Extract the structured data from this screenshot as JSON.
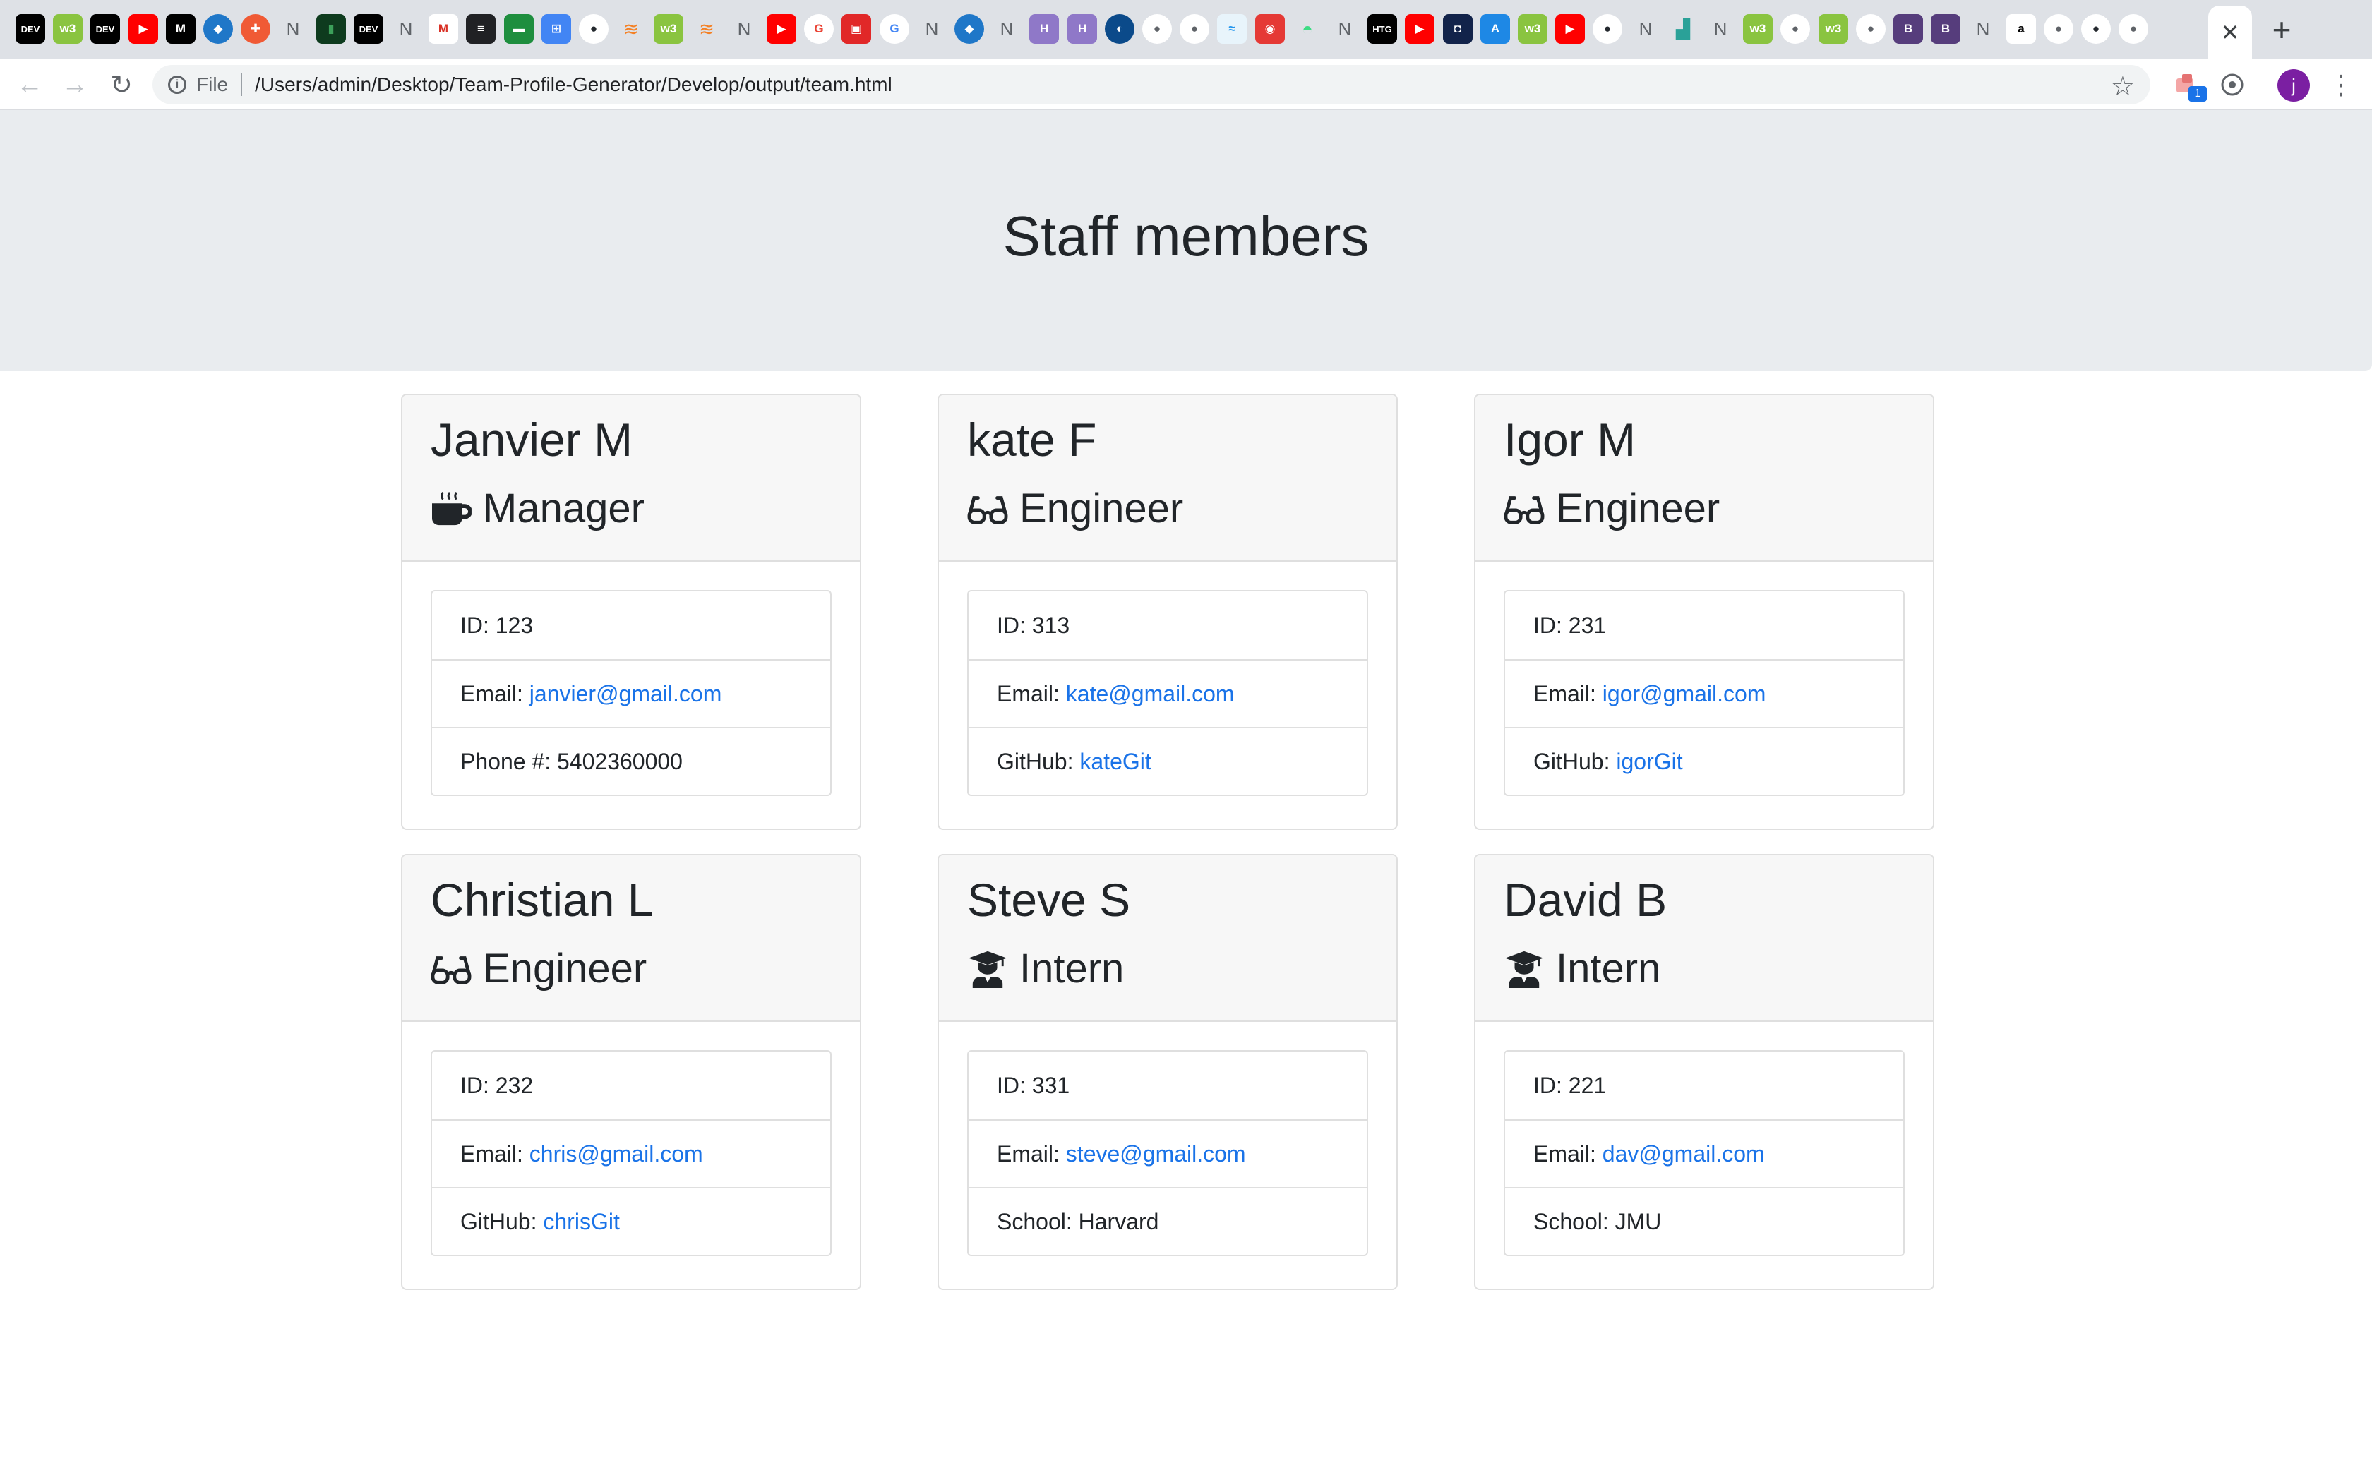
{
  "browser": {
    "tabs": [
      {
        "name": "dev-tab-icon",
        "text": "DEV",
        "bg": "#000000",
        "fg": "#ffffff",
        "shape": "square"
      },
      {
        "name": "w3-tab-icon",
        "text": "w3",
        "bg": "#8ac440",
        "fg": "#ffffff",
        "shape": "square"
      },
      {
        "name": "dev-tab-icon",
        "text": "DEV",
        "bg": "#000000",
        "fg": "#ffffff",
        "shape": "square"
      },
      {
        "name": "youtube-tab-icon",
        "text": "▶",
        "bg": "#ff0000",
        "fg": "#ffffff",
        "shape": "square"
      },
      {
        "name": "medium-tab-icon",
        "text": "M",
        "bg": "#000000",
        "fg": "#ffffff",
        "shape": "square"
      },
      {
        "name": "cube-tab-icon",
        "text": "◆",
        "bg": "#1f77c8",
        "fg": "#ffffff",
        "shape": "round"
      },
      {
        "name": "pocket-tab-icon",
        "text": "✚",
        "bg": "#f05a35",
        "fg": "#ffffff",
        "shape": "round"
      },
      {
        "name": "notion-tab-icon",
        "text": "N",
        "bg": "transparent",
        "fg": "#5f6368",
        "shape": "n"
      },
      {
        "name": "leaf-tab-icon",
        "text": "▮",
        "bg": "#0e3b1e",
        "fg": "#3ca05a",
        "shape": "square"
      },
      {
        "name": "dev-tab-icon",
        "text": "DEV",
        "bg": "#000000",
        "fg": "#ffffff",
        "shape": "square"
      },
      {
        "name": "notion-tab-icon",
        "text": "N",
        "bg": "transparent",
        "fg": "#5f6368",
        "shape": "n"
      },
      {
        "name": "gmail-tab-icon",
        "text": "M",
        "bg": "#ffffff",
        "fg": "#d93025",
        "shape": "square"
      },
      {
        "name": "doc-tab-icon",
        "text": "≡",
        "bg": "#202124",
        "fg": "#ffffff",
        "shape": "square"
      },
      {
        "name": "chat-tab-icon",
        "text": "▬",
        "bg": "#1e8e3e",
        "fg": "#ffffff",
        "shape": "square"
      },
      {
        "name": "calc-tab-icon",
        "text": "⊞",
        "bg": "#4285f4",
        "fg": "#ffffff",
        "shape": "square"
      },
      {
        "name": "github-tab-icon",
        "text": "●",
        "bg": "#ffffff",
        "fg": "#24292e",
        "shape": "round"
      },
      {
        "name": "stackoverflow-tab-icon",
        "text": "≋",
        "bg": "transparent",
        "fg": "#f48024",
        "shape": "n"
      },
      {
        "name": "w3-tab-icon",
        "text": "w3",
        "bg": "#8ac440",
        "fg": "#ffffff",
        "shape": "square"
      },
      {
        "name": "stackoverflow-tab-icon",
        "text": "≋",
        "bg": "transparent",
        "fg": "#f48024",
        "shape": "n"
      },
      {
        "name": "notion-tab-icon",
        "text": "N",
        "bg": "transparent",
        "fg": "#5f6368",
        "shape": "n"
      },
      {
        "name": "youtube-tab-icon",
        "text": "▶",
        "bg": "#ff0000",
        "fg": "#ffffff",
        "shape": "square"
      },
      {
        "name": "google-tab-icon",
        "text": "G",
        "bg": "#ffffff",
        "fg": "#ea4335",
        "shape": "round"
      },
      {
        "name": "flipboard-tab-icon",
        "text": "▣",
        "bg": "#e12828",
        "fg": "#ffffff",
        "shape": "square"
      },
      {
        "name": "google-tab-icon",
        "text": "G",
        "bg": "#ffffff",
        "fg": "#4285f4",
        "shape": "round"
      },
      {
        "name": "notion-tab-icon",
        "text": "N",
        "bg": "transparent",
        "fg": "#5f6368",
        "shape": "n"
      },
      {
        "name": "cube-tab-icon",
        "text": "◆",
        "bg": "#1f77c8",
        "fg": "#ffffff",
        "shape": "round"
      },
      {
        "name": "notion-tab-icon",
        "text": "N",
        "bg": "transparent",
        "fg": "#5f6368",
        "shape": "n"
      },
      {
        "name": "heroku-tab-icon",
        "text": "H",
        "bg": "#8f78c8",
        "fg": "#ffffff",
        "shape": "square"
      },
      {
        "name": "heroku-tab-icon",
        "text": "H",
        "bg": "#8f78c8",
        "fg": "#ffffff",
        "shape": "square"
      },
      {
        "name": "digitalocean-tab-icon",
        "text": "◐",
        "bg": "#0b4a8a",
        "fg": "#ffffff",
        "shape": "round"
      },
      {
        "name": "globe-tab-icon",
        "text": "●",
        "bg": "#ffffff",
        "fg": "#5f6368",
        "shape": "round"
      },
      {
        "name": "globe-tab-icon",
        "text": "●",
        "bg": "#ffffff",
        "fg": "#5f6368",
        "shape": "round"
      },
      {
        "name": "docker-tab-icon",
        "text": "≈",
        "bg": "#e8f4fb",
        "fg": "#2496ed",
        "shape": "square"
      },
      {
        "name": "camera-tab-icon",
        "text": "◉",
        "bg": "#e53935",
        "fg": "#ffffff",
        "shape": "square"
      },
      {
        "name": "android-tab-icon",
        "text": "◓",
        "bg": "transparent",
        "fg": "#3ddc84",
        "shape": "n"
      },
      {
        "name": "notion-tab-icon",
        "text": "N",
        "bg": "transparent",
        "fg": "#5f6368",
        "shape": "n"
      },
      {
        "name": "htg-tab-icon",
        "text": "HTG",
        "bg": "#000000",
        "fg": "#ffffff",
        "shape": "square"
      },
      {
        "name": "youtube-tab-icon",
        "text": "▶",
        "bg": "#ff0000",
        "fg": "#ffffff",
        "shape": "square"
      },
      {
        "name": "dark-tab-icon",
        "text": "◘",
        "bg": "#12234a",
        "fg": "#ffffff",
        "shape": "square"
      },
      {
        "name": "appstore-tab-icon",
        "text": "A",
        "bg": "#1e88e5",
        "fg": "#ffffff",
        "shape": "square"
      },
      {
        "name": "w3-tab-icon",
        "text": "w3",
        "bg": "#8ac440",
        "fg": "#ffffff",
        "shape": "square"
      },
      {
        "name": "youtube-tab-icon",
        "text": "▶",
        "bg": "#ff0000",
        "fg": "#ffffff",
        "shape": "square"
      },
      {
        "name": "github-tab-icon",
        "text": "●",
        "bg": "#ffffff",
        "fg": "#24292e",
        "shape": "round"
      },
      {
        "name": "notion-tab-icon",
        "text": "N",
        "bg": "transparent",
        "fg": "#5f6368",
        "shape": "n"
      },
      {
        "name": "chart-tab-icon",
        "text": "▟",
        "bg": "transparent",
        "fg": "#2aa198",
        "shape": "n"
      },
      {
        "name": "notion-tab-icon",
        "text": "N",
        "bg": "transparent",
        "fg": "#5f6368",
        "shape": "n"
      },
      {
        "name": "w3-tab-icon",
        "text": "w3",
        "bg": "#8ac440",
        "fg": "#ffffff",
        "shape": "square"
      },
      {
        "name": "globe-tab-icon",
        "text": "●",
        "bg": "#ffffff",
        "fg": "#5f6368",
        "shape": "round"
      },
      {
        "name": "w3-tab-icon",
        "text": "w3",
        "bg": "#8ac440",
        "fg": "#ffffff",
        "shape": "square"
      },
      {
        "name": "globe-tab-icon",
        "text": "●",
        "bg": "#ffffff",
        "fg": "#5f6368",
        "shape": "round"
      },
      {
        "name": "bootstrap-tab-icon",
        "text": "B",
        "bg": "#563d7c",
        "fg": "#ffffff",
        "shape": "square"
      },
      {
        "name": "bootstrap-tab-icon",
        "text": "B",
        "bg": "#563d7c",
        "fg": "#ffffff",
        "shape": "square"
      },
      {
        "name": "notion-tab-icon",
        "text": "N",
        "bg": "transparent",
        "fg": "#5f6368",
        "shape": "n"
      },
      {
        "name": "amazon-tab-icon",
        "text": "a",
        "bg": "#ffffff",
        "fg": "#000000",
        "shape": "square"
      },
      {
        "name": "globe-tab-icon",
        "text": "●",
        "bg": "#ffffff",
        "fg": "#5f6368",
        "shape": "round"
      },
      {
        "name": "github-tab-icon",
        "text": "●",
        "bg": "#ffffff",
        "fg": "#24292e",
        "shape": "round"
      },
      {
        "name": "globe-tab-icon",
        "text": "●",
        "bg": "#ffffff",
        "fg": "#5f6368",
        "shape": "round"
      }
    ],
    "active_tab_close": "✕",
    "new_tab": "+",
    "back": "←",
    "forward": "→",
    "reload": "↻",
    "info_glyph": "i",
    "scheme_label": "File",
    "url": "/Users/admin/Desktop/Team-Profile-Generator/Develop/output/team.html",
    "star": "☆",
    "extension_badge": "1",
    "avatar_letter": "j",
    "menu": "⋮"
  },
  "page": {
    "title": "Staff members"
  },
  "colors": {
    "link": "#1a73e8",
    "jumbotron": "#e9ecef",
    "card_header": "#f7f7f7"
  },
  "team": [
    {
      "name": "Janvier M",
      "role": "Manager",
      "icon": "coffee-icon",
      "rows": [
        {
          "label": "ID: ",
          "value": "123",
          "link": false
        },
        {
          "label": "Email: ",
          "value": "janvier@gmail.com",
          "link": true
        },
        {
          "label": "Phone #: ",
          "value": "5402360000",
          "link": false
        }
      ]
    },
    {
      "name": "kate F",
      "role": "Engineer",
      "icon": "glasses-icon",
      "rows": [
        {
          "label": "ID: ",
          "value": "313",
          "link": false
        },
        {
          "label": "Email: ",
          "value": "kate@gmail.com",
          "link": true
        },
        {
          "label": "GitHub: ",
          "value": "kateGit",
          "link": true
        }
      ]
    },
    {
      "name": "Igor M",
      "role": "Engineer",
      "icon": "glasses-icon",
      "rows": [
        {
          "label": "ID: ",
          "value": "231",
          "link": false
        },
        {
          "label": "Email: ",
          "value": "igor@gmail.com",
          "link": true
        },
        {
          "label": "GitHub: ",
          "value": "igorGit",
          "link": true
        }
      ]
    },
    {
      "name": "Christian L",
      "role": "Engineer",
      "icon": "glasses-icon",
      "rows": [
        {
          "label": "ID: ",
          "value": "232",
          "link": false
        },
        {
          "label": "Email: ",
          "value": "chris@gmail.com",
          "link": true
        },
        {
          "label": "GitHub: ",
          "value": "chrisGit",
          "link": true
        }
      ]
    },
    {
      "name": "Steve S",
      "role": "Intern",
      "icon": "graduate-icon",
      "rows": [
        {
          "label": "ID: ",
          "value": "331",
          "link": false
        },
        {
          "label": "Email: ",
          "value": "steve@gmail.com",
          "link": true
        },
        {
          "label": "School: ",
          "value": "Harvard",
          "link": false
        }
      ]
    },
    {
      "name": "David B",
      "role": "Intern",
      "icon": "graduate-icon",
      "rows": [
        {
          "label": "ID: ",
          "value": "221",
          "link": false
        },
        {
          "label": "Email: ",
          "value": "dav@gmail.com",
          "link": true
        },
        {
          "label": "School: ",
          "value": "JMU",
          "link": false
        }
      ]
    }
  ]
}
